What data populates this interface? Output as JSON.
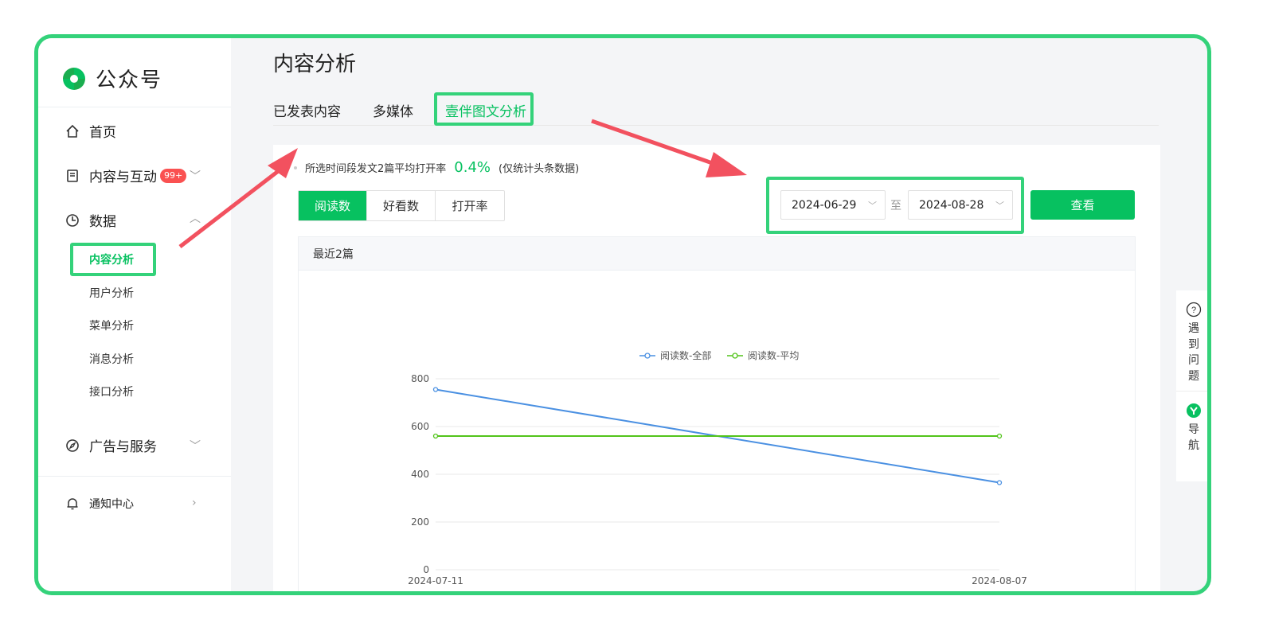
{
  "sidebar": {
    "logo_text": "公众号",
    "nav": {
      "home": "首页",
      "content": "内容与互动",
      "content_badge": "99+",
      "data": "数据",
      "ads": "广告与服务",
      "notice": "通知中心"
    },
    "data_sub": [
      "内容分析",
      "用户分析",
      "菜单分析",
      "消息分析",
      "接口分析"
    ]
  },
  "main": {
    "title": "内容分析",
    "tabs": [
      "已发表内容",
      "多媒体",
      "壹伴图文分析"
    ],
    "summary": {
      "prefix": "所选时间段发文2篇平均打开率",
      "rate": "0.4%",
      "note": "(仅统计头条数据)"
    },
    "metrics": [
      "阅读数",
      "好看数",
      "打开率"
    ],
    "date_from": "2024-06-29",
    "date_to": "2024-08-28",
    "to_label": "至",
    "query_label": "查看",
    "chart_title": "最近2篇"
  },
  "helper": {
    "help_label": "遇到问题",
    "nav_label": "导航"
  },
  "colors": {
    "accent": "#07c160",
    "highlight": "#34d27a",
    "arrow": "#f2515f",
    "series_all": "#4a90e2",
    "series_avg": "#52c41a"
  },
  "chart_data": {
    "type": "line",
    "x": [
      "2024-07-11",
      "2024-08-07"
    ],
    "series": [
      {
        "name": "阅读数-全部",
        "values": [
          755,
          365
        ]
      },
      {
        "name": "阅读数-平均",
        "values": [
          560,
          560
        ]
      }
    ],
    "ylim": [
      0,
      800
    ],
    "yticks": [
      0,
      200,
      400,
      600,
      800
    ],
    "legend": "top-center",
    "grid": true
  }
}
